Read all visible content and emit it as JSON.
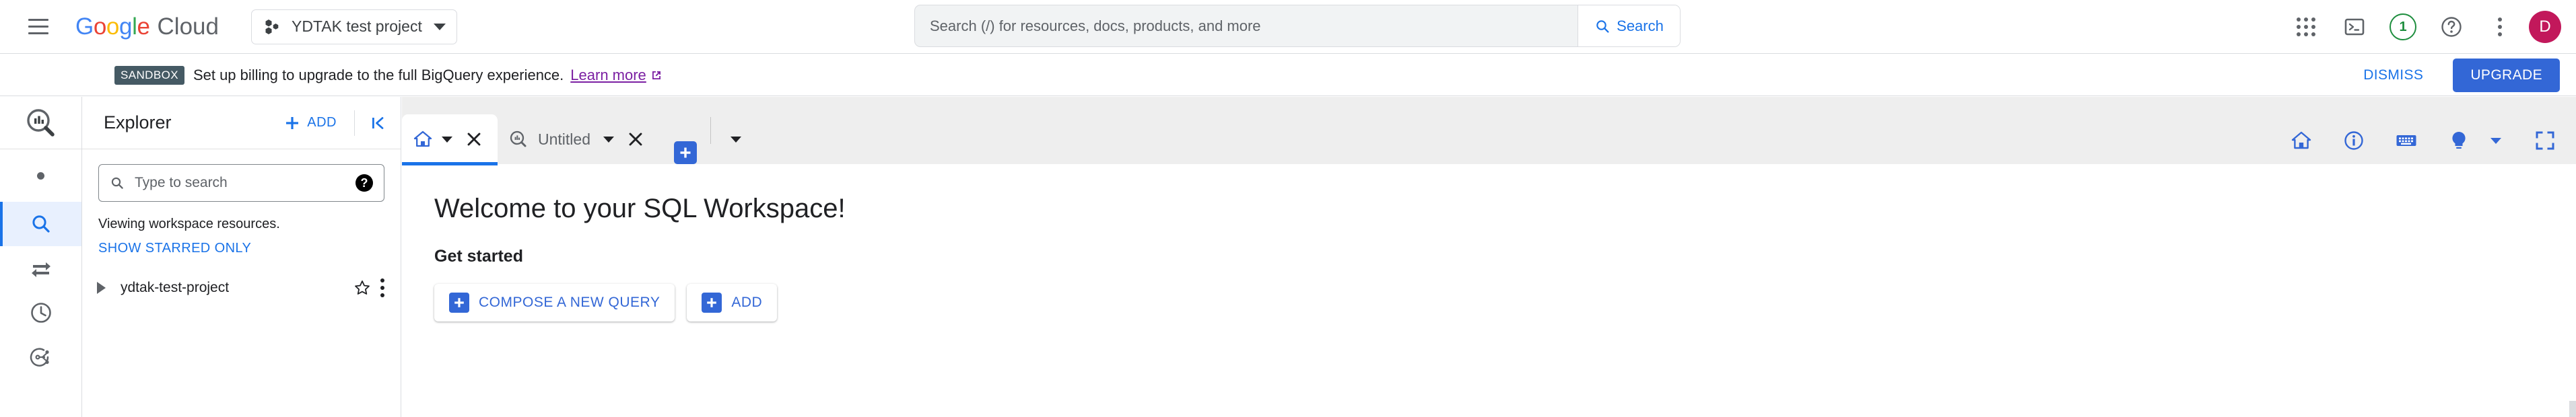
{
  "topbar": {
    "menu_icon": "hamburger-menu-icon",
    "logo_google": "Google",
    "logo_cloud": "Cloud",
    "project_selector": {
      "icon": "project-hexagons-icon",
      "label": "YDTAK test project",
      "caret": "chevron-down-icon"
    },
    "search": {
      "placeholder": "Search (/) for resources, docs, products, and more",
      "value": "",
      "button_label": "Search",
      "button_icon": "search-icon"
    },
    "icons": [
      {
        "name": "apps-grid-icon"
      },
      {
        "name": "cloud-shell-terminal-icon"
      },
      {
        "name": "notifications-badge-icon",
        "count": "1"
      },
      {
        "name": "help-question-icon"
      },
      {
        "name": "more-options-kebab-icon"
      }
    ],
    "avatar": {
      "initial": "D",
      "color": "#c2185b"
    }
  },
  "banner": {
    "badge": "SANDBOX",
    "text": "Set up billing to upgrade to the full BigQuery experience.",
    "link_label": "Learn more",
    "link_icon": "external-link-icon",
    "link_color": "#7b1fa2",
    "dismiss_label": "DISMISS",
    "upgrade_label": "UPGRADE",
    "upgrade_color": "#3367d6"
  },
  "rail": {
    "logo_icon": "bigquery-logo-icon",
    "dot_icon": "collapsed-section-dot-icon",
    "items": [
      {
        "name": "sidebar-item-search",
        "icon": "search-icon",
        "active": true
      },
      {
        "name": "sidebar-item-transfers",
        "icon": "transfer-arrows-icon",
        "active": false
      },
      {
        "name": "sidebar-item-scheduled-queries",
        "icon": "clock-history-icon",
        "active": false
      },
      {
        "name": "sidebar-item-analytics-hub",
        "icon": "data-share-icon",
        "active": false
      }
    ]
  },
  "explorer": {
    "title": "Explorer",
    "add_label": "ADD",
    "add_icon": "plus-icon",
    "collapse_icon": "collapse-panel-icon",
    "search": {
      "placeholder": "Type to search",
      "value": "",
      "icon": "search-icon",
      "help_icon": "help-filled-icon"
    },
    "note": "Viewing workspace resources.",
    "starred_label": "SHOW STARRED ONLY",
    "tree": [
      {
        "label": "ydtak-test-project",
        "expand_icon": "triangle-right-icon",
        "star_icon": "star-outline-icon",
        "menu_icon": "more-vert-icon"
      }
    ]
  },
  "tabs": {
    "items": [
      {
        "name": "tab-home",
        "icon": "home-icon",
        "label": "",
        "caret": "chevron-down-icon",
        "close": "close-x-icon",
        "active": true
      },
      {
        "name": "tab-untitled-query",
        "icon": "bigquery-icon",
        "label": "Untitled",
        "caret": "chevron-down-icon",
        "close": "close-x-icon",
        "active": false
      }
    ],
    "new_tab_icon": "plus-icon",
    "new_tab_caret": "chevron-down-icon",
    "right_icons": [
      {
        "name": "home-icon"
      },
      {
        "name": "info-circle-icon"
      },
      {
        "name": "keyboard-shortcuts-icon"
      },
      {
        "name": "lightbulb-tips-icon"
      },
      {
        "name": "lightbulb-caret-icon"
      },
      {
        "name": "fullscreen-icon"
      }
    ]
  },
  "content": {
    "welcome_title": "Welcome to your SQL Workspace!",
    "get_started_title": "Get started",
    "buttons": [
      {
        "name": "compose-new-query-button",
        "icon": "plus-box-icon",
        "label": "COMPOSE A NEW QUERY"
      },
      {
        "name": "add-data-button",
        "icon": "plus-box-icon",
        "label": "ADD"
      }
    ]
  }
}
